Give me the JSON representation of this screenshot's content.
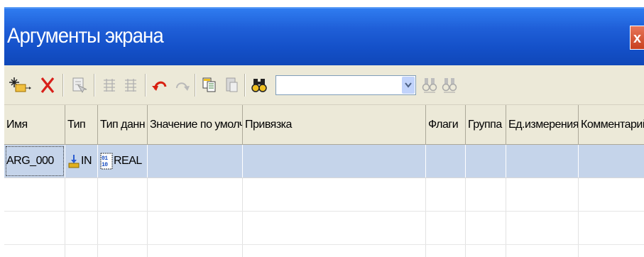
{
  "window": {
    "title": "Аргументы экрана",
    "close_label": "x"
  },
  "toolbar": {
    "icons": [
      "new-icon",
      "delete-icon",
      "properties-icon",
      "grid-icon",
      "grid-alt-icon",
      "undo-icon",
      "redo-icon",
      "copy-icon",
      "paste-icon",
      "find-icon",
      "find-next-icon",
      "find-prev-icon"
    ],
    "search": {
      "value": ""
    }
  },
  "table": {
    "columns": [
      "Имя",
      "Тип",
      "Тип данн",
      "Значение по умолч",
      "Привязка",
      "Флаги",
      "Группа",
      "Ед.измерения",
      "Комментарий"
    ],
    "rows": [
      {
        "name": "ARG_000",
        "type": "IN",
        "type_icon": "input-arrow-icon",
        "data_type": "REAL",
        "data_type_icon": "binary-data-icon",
        "default": "",
        "binding": "",
        "flags": "",
        "group": "",
        "unit": "",
        "comment": ""
      }
    ],
    "empty_rows": 3
  },
  "colors": {
    "title_bar": "#1f5fd8",
    "selected_row": "#c5d4ea",
    "toolbar_bg": "#ece9d8"
  }
}
